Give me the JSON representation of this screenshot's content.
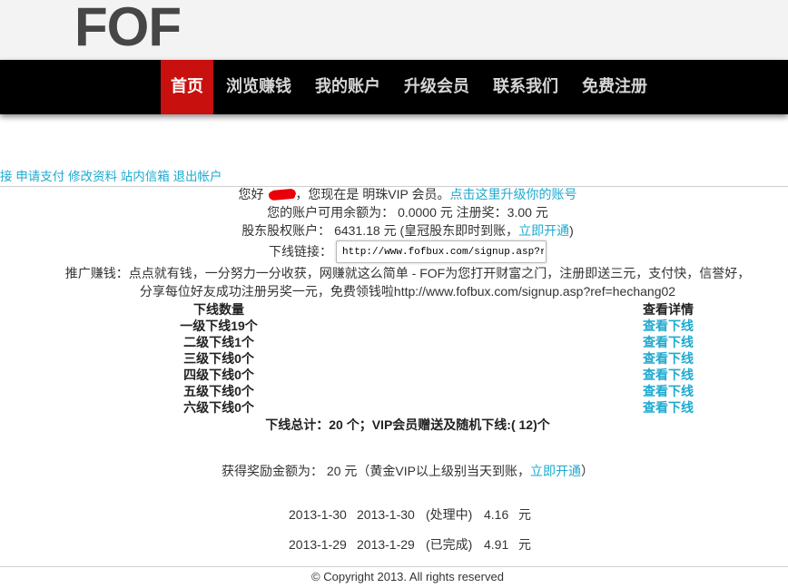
{
  "colors": {
    "nav_bg": "#000000",
    "nav_active_bg": "#c8100f",
    "nav_text": "#d6d6d6",
    "link": "#1eaad0",
    "text": "#333333",
    "logo": "#464646",
    "redaction": "#e8000b"
  },
  "header": {
    "logo": "FOF"
  },
  "nav": {
    "active_index": 0,
    "items": [
      {
        "label": "首页"
      },
      {
        "label": "浏览赚钱"
      },
      {
        "label": "我的账户"
      },
      {
        "label": "升级会员"
      },
      {
        "label": "联系我们"
      },
      {
        "label": "免费注册"
      }
    ]
  },
  "account_links": [
    "接",
    "申请支付",
    "修改资料",
    "站内信箱",
    "退出帐户"
  ],
  "greeting": {
    "hello": "您好",
    "status": "，您现在是 明珠VIP 会员。",
    "upgrade_link": "点击这里升级你的账号"
  },
  "balance": {
    "label": "您的账户可用余额为：",
    "amount": "0.0000",
    "unit": "元",
    "bonus_label": "注册奖：",
    "bonus_amount": "3.00",
    "bonus_unit": "元"
  },
  "equity": {
    "label": "股东股权账户：",
    "amount": "6431.18",
    "unit": "元",
    "note_open": "(皇冠股东即时到账，",
    "open_link": "立即开通",
    "note_close": ")"
  },
  "referral": {
    "label": "下线链接：",
    "url": "http://www.fofbux.com/signup.asp?r"
  },
  "promo": {
    "line1": "推广赚钱：点点就有钱，一分努力一分收获，网赚就这么简单 - FOF为您打开财富之门，注册即送三元，支付快，信誉好，",
    "line2": "分享每位好友成功注册另奖一元，免费领钱啦http://www.fofbux.com/signup.asp?ref=hechang02"
  },
  "downlines": {
    "headers": {
      "count": "下线数量",
      "details": "查看详情"
    },
    "rows": [
      {
        "level": "一级下线",
        "count": "19",
        "unit": "个",
        "action": "查看下线"
      },
      {
        "level": "二级下线",
        "count": "1",
        "unit": "个",
        "action": "查看下线"
      },
      {
        "level": "三级下线",
        "count": "0",
        "unit": "个",
        "action": "查看下线"
      },
      {
        "level": "四级下线",
        "count": "0",
        "unit": "个",
        "action": "查看下线"
      },
      {
        "level": "五级下线",
        "count": "0",
        "unit": "个",
        "action": "查看下线"
      },
      {
        "level": "六级下线",
        "count": "0",
        "unit": "个",
        "action": "查看下线"
      }
    ]
  },
  "totals": {
    "label": "下线总计：",
    "count": "20",
    "unit": "个；",
    "vip_label": "VIP会员赠送及随机下线:(",
    "vip_count": "12",
    "vip_unit": ")个"
  },
  "reward": {
    "label": "获得奖励金额为：",
    "amount": "20",
    "unit": "元",
    "note_open": "（黄金VIP以上级别当天到账，",
    "open_link": "立即开通",
    "note_close": "）"
  },
  "payments": [
    {
      "date_1": "2013-1-30",
      "date_2": "2013-1-30",
      "status": "(处理中)",
      "amount": "4.16",
      "unit": "元"
    },
    {
      "date_1": "2013-1-29",
      "date_2": "2013-1-29",
      "status": "(已完成)",
      "amount": "4.91",
      "unit": "元"
    }
  ],
  "footer": {
    "copyright": "© Copyright 2013. All rights reserved"
  }
}
